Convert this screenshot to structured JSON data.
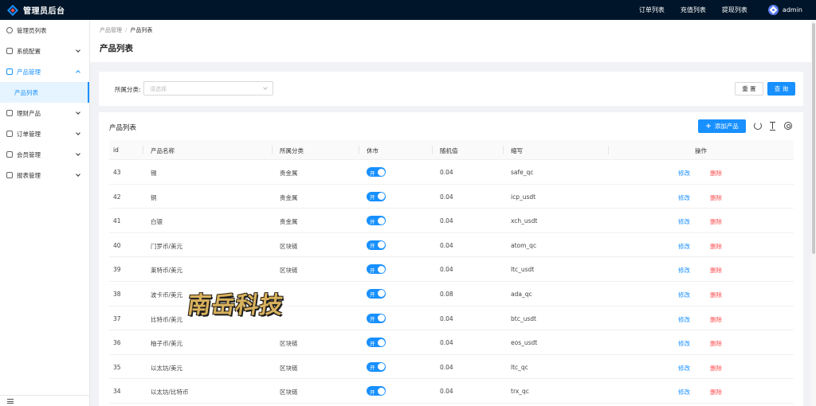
{
  "app": {
    "title": "管理员后台"
  },
  "topnav": {
    "items": [
      "订单列表",
      "充值列表",
      "提现列表"
    ],
    "user": "admin"
  },
  "sidebar": {
    "items": [
      {
        "label": "管理员列表",
        "icon": "user-circle-icon",
        "expandable": false
      },
      {
        "label": "系统配置",
        "icon": "home-icon",
        "expandable": true
      },
      {
        "label": "产品管理",
        "icon": "home-icon",
        "expandable": true,
        "open": true,
        "children": [
          "产品列表"
        ]
      },
      {
        "label": "理财产品",
        "icon": "home-icon",
        "expandable": true
      },
      {
        "label": "订单管理",
        "icon": "home-icon",
        "expandable": true
      },
      {
        "label": "会员管理",
        "icon": "home-icon",
        "expandable": true
      },
      {
        "label": "报表管理",
        "icon": "home-icon",
        "expandable": true
      }
    ]
  },
  "breadcrumb": {
    "parent": "产品管理",
    "separator": "/",
    "current": "产品列表"
  },
  "page": {
    "title": "产品列表"
  },
  "filter": {
    "label": "所属分类:",
    "placeholder": "请选择",
    "reset_label": "重 置",
    "query_label": "查 询"
  },
  "table": {
    "title": "产品列表",
    "add_label": "添加产品",
    "columns": [
      "id",
      "产品名称",
      "所属分类",
      "休市",
      "随机值",
      "缩写",
      "操作"
    ],
    "switch_label": "开",
    "edit_label": "修改",
    "delete_label": "删除",
    "rows": [
      {
        "id": "43",
        "name": "锡",
        "category": "贵金属",
        "random": "0.04",
        "abbr": "safe_qc"
      },
      {
        "id": "42",
        "name": "铜",
        "category": "贵金属",
        "random": "0.04",
        "abbr": "icp_usdt"
      },
      {
        "id": "41",
        "name": "白银",
        "category": "贵金属",
        "random": "0.04",
        "abbr": "xch_usdt"
      },
      {
        "id": "40",
        "name": "门罗币/美元",
        "category": "区块链",
        "random": "0.04",
        "abbr": "atom_qc"
      },
      {
        "id": "39",
        "name": "莱特币/美元",
        "category": "区块链",
        "random": "0.04",
        "abbr": "ltc_usdt"
      },
      {
        "id": "38",
        "name": "波卡币/美元",
        "category": "",
        "random": "0.08",
        "abbr": "ada_qc"
      },
      {
        "id": "37",
        "name": "比特币/美元",
        "category": "",
        "random": "0.04",
        "abbr": "btc_usdt"
      },
      {
        "id": "36",
        "name": "柚子币/美元",
        "category": "区块链",
        "random": "0.04",
        "abbr": "eos_usdt"
      },
      {
        "id": "35",
        "name": "以太坊/美元",
        "category": "区块链",
        "random": "0.04",
        "abbr": "ltc_qc"
      },
      {
        "id": "34",
        "name": "以太坊/比特币",
        "category": "区块链",
        "random": "0.04",
        "abbr": "trx_qc"
      }
    ]
  },
  "watermark": {
    "text": "南岳科技"
  },
  "colors": {
    "primary": "#1890ff",
    "header": "#001529",
    "danger": "#ff4d4f"
  }
}
